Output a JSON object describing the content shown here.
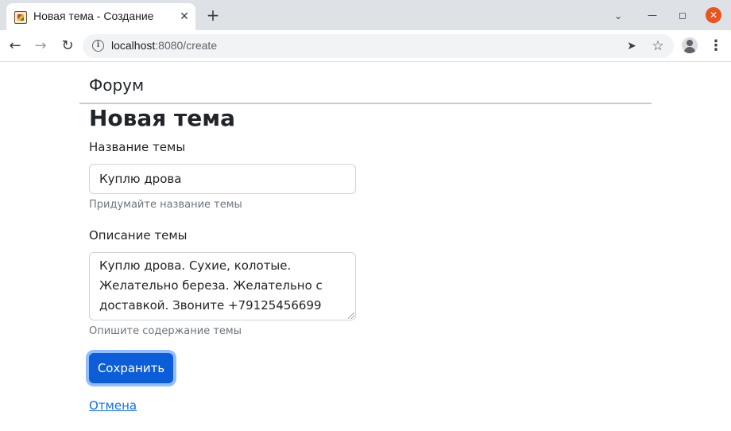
{
  "browser": {
    "tab_title": "Новая тема - Создание",
    "tab_close": "✕",
    "new_tab": "+",
    "url_host": "localhost",
    "url_rest": ":8080/create"
  },
  "page": {
    "brand": "Форум",
    "title": "Новая тема",
    "form": {
      "title_label": "Название темы",
      "title_value": "Куплю дрова",
      "title_help": "Придумайте название темы",
      "desc_label": "Описание темы",
      "desc_value": "Куплю дрова. Сухие, колотые. Желательно береза. Желательно с доставкой. Звоните +79125456699",
      "desc_help": "Опишите содержание темы",
      "save_label": "Сохранить",
      "cancel_label": "Отмена"
    }
  },
  "colors": {
    "primary": "#0b5ed7",
    "link": "#0d6efd",
    "muted": "#6c757d",
    "close_button": "#e95420"
  }
}
